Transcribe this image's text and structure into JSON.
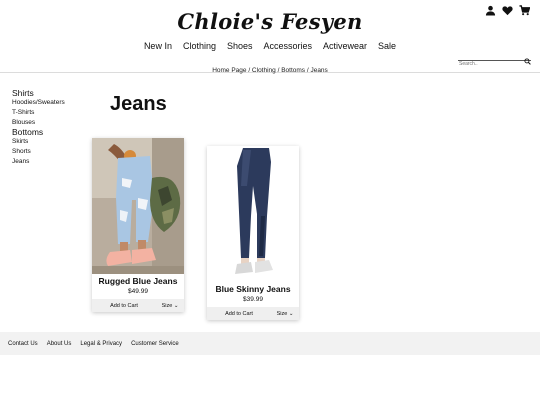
{
  "brand": {
    "logo_text": "Chloie's Fesyen"
  },
  "header": {
    "icons": [
      "user-icon",
      "heart-icon",
      "cart-icon"
    ]
  },
  "nav": {
    "items": [
      "New In",
      "Clothing",
      "Shoes",
      "Accessories",
      "Activewear",
      "Sale"
    ]
  },
  "search": {
    "placeholder": "Search.."
  },
  "breadcrumb": {
    "text": "Home Page / Clothing / Bottoms / Jeans"
  },
  "sidebar": {
    "groups": [
      {
        "label": "Shirts",
        "items": [
          "Hoodies/Sweaters",
          "T-Shirts",
          "Blouses"
        ]
      },
      {
        "label": "Bottoms",
        "items": [
          "Skirts",
          "Shorts",
          "Jeans"
        ]
      }
    ]
  },
  "page": {
    "title": "Jeans"
  },
  "products": [
    {
      "name": "Rugged Blue Jeans",
      "price": "$49.99",
      "add_label": "Add to Cart",
      "size_label": "Size"
    },
    {
      "name": "Blue Skinny Jeans",
      "price": "$39.99",
      "add_label": "Add to Cart",
      "size_label": "Size"
    }
  ],
  "footer": {
    "links": [
      "Contact Us",
      "About Us",
      "Legal & Privacy",
      "Customer Service"
    ]
  },
  "colors": {
    "footer_bg": "#f2f2f2",
    "card_actions_bg": "#efefef",
    "text": "#111111"
  }
}
